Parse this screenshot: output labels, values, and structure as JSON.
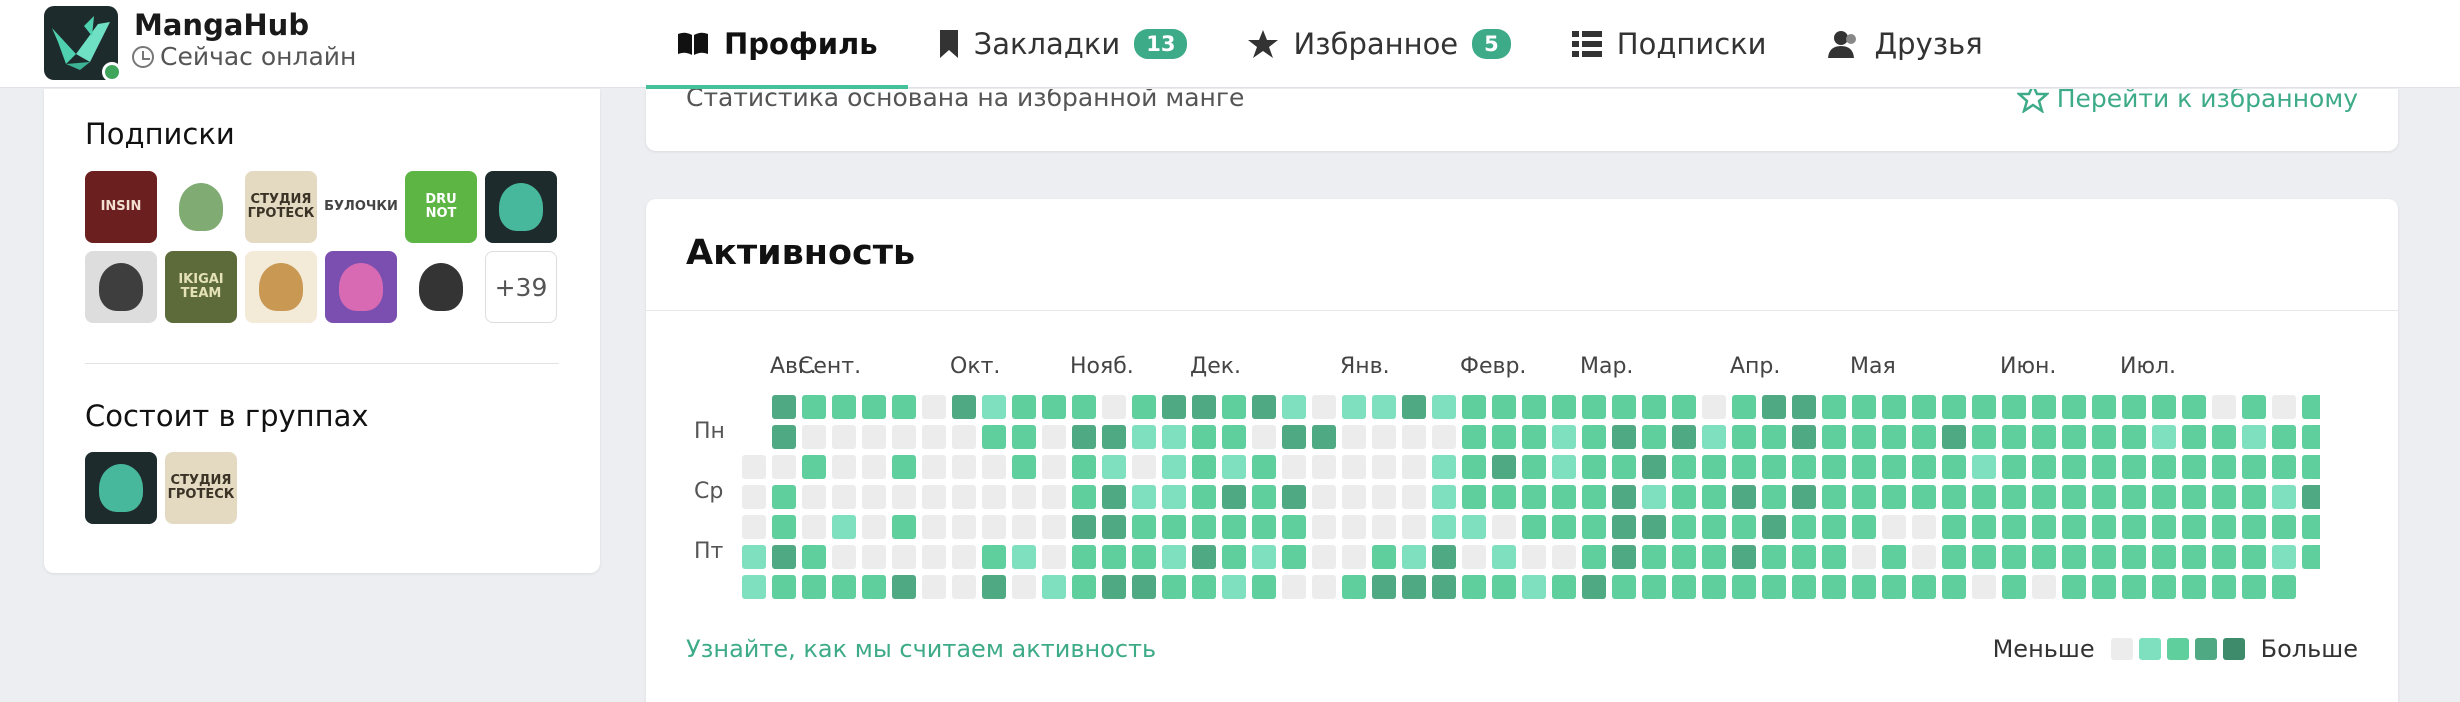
{
  "header": {
    "site_name": "MangaHub",
    "status": "Сейчас онлайн",
    "tabs": [
      {
        "label": "Профиль",
        "badge": null
      },
      {
        "label": "Закладки",
        "badge": "13"
      },
      {
        "label": "Избранное",
        "badge": "5"
      },
      {
        "label": "Подписки",
        "badge": null
      },
      {
        "label": "Друзья",
        "badge": null
      }
    ]
  },
  "sidebar": {
    "subscriptions_title": "Подписки",
    "subscriptions_more": "+39",
    "subscription_avatars": [
      {
        "text": "INSIN",
        "bg": "#6b1f1f",
        "fg": "#f3e0d0"
      },
      {
        "text": "",
        "bg": "#ffffff",
        "fg": "#6a9c5b"
      },
      {
        "text": "СТУДИЯ ГРОТЕСК",
        "bg": "#e4dac2",
        "fg": "#3a3326"
      },
      {
        "text": "БУЛОЧКИ",
        "bg": "#ffffff",
        "fg": "#444444"
      },
      {
        "text": "DRU NOT",
        "bg": "#5db544",
        "fg": "#ffffff"
      },
      {
        "text": "",
        "bg": "#1d2b2d",
        "fg": "#4fd1b0"
      },
      {
        "text": "",
        "bg": "#dddddd",
        "fg": "#222222"
      },
      {
        "text": "IKIGAI TEAM",
        "bg": "#5d6b3a",
        "fg": "#e6e2b8"
      },
      {
        "text": "",
        "bg": "#f3ead8",
        "fg": "#c18a3c"
      },
      {
        "text": "",
        "bg": "#7a4fb0",
        "fg": "#e86fb3"
      },
      {
        "text": "",
        "bg": "#ffffff",
        "fg": "#111111"
      }
    ],
    "groups_title": "Состоит в группах",
    "group_avatars": [
      {
        "text": "",
        "bg": "#1d2b2d",
        "fg": "#4fd1b0"
      },
      {
        "text": "СТУДИЯ ГРОТЕСК",
        "bg": "#e4dac2",
        "fg": "#3a3326"
      }
    ]
  },
  "stats_card": {
    "note": "Статистика основана на избранной манге",
    "link": "Перейти к избранному"
  },
  "activity": {
    "title": "Активность",
    "months": [
      "Авг.",
      "Сент.",
      "Окт.",
      "Нояб.",
      "Дек.",
      "Янв.",
      "Февр.",
      "Мар.",
      "Апр.",
      "Мая",
      "Июн.",
      "Июл."
    ],
    "days": [
      "Пн",
      "Ср",
      "Пт"
    ],
    "link": "Узнайте, как мы считаем активность",
    "legend_less": "Меньше",
    "legend_more": "Больше",
    "levels_colors": [
      "#ececec",
      "#7fe0bf",
      "#5fcf9e",
      "#4fa983",
      "#3d8b6a"
    ],
    "weeks": [
      [
        null,
        null,
        0,
        0,
        0,
        1,
        1
      ],
      [
        3,
        3,
        0,
        2,
        2,
        3,
        2
      ],
      [
        2,
        0,
        2,
        0,
        0,
        2,
        2
      ],
      [
        2,
        0,
        0,
        0,
        1,
        0,
        2
      ],
      [
        2,
        0,
        0,
        0,
        0,
        0,
        2
      ],
      [
        2,
        0,
        2,
        0,
        2,
        0,
        3
      ],
      [
        0,
        0,
        0,
        0,
        0,
        0,
        0
      ],
      [
        3,
        0,
        0,
        0,
        0,
        0,
        0
      ],
      [
        1,
        2,
        0,
        0,
        0,
        2,
        3
      ],
      [
        2,
        2,
        2,
        0,
        0,
        1,
        0
      ],
      [
        2,
        0,
        0,
        0,
        0,
        0,
        1
      ],
      [
        2,
        3,
        2,
        2,
        3,
        2,
        2
      ],
      [
        0,
        3,
        1,
        3,
        3,
        2,
        3
      ],
      [
        2,
        1,
        0,
        1,
        2,
        2,
        3
      ],
      [
        3,
        1,
        1,
        1,
        2,
        1,
        2
      ],
      [
        3,
        2,
        2,
        2,
        2,
        3,
        2
      ],
      [
        2,
        2,
        1,
        3,
        2,
        2,
        1
      ],
      [
        3,
        0,
        2,
        2,
        2,
        1,
        2
      ],
      [
        1,
        3,
        0,
        3,
        2,
        2,
        0
      ],
      [
        0,
        3,
        0,
        0,
        0,
        0,
        0
      ],
      [
        1,
        0,
        0,
        0,
        0,
        0,
        2
      ],
      [
        1,
        0,
        0,
        0,
        0,
        2,
        3
      ],
      [
        3,
        0,
        0,
        0,
        0,
        1,
        3
      ],
      [
        1,
        0,
        1,
        1,
        1,
        3,
        3
      ],
      [
        2,
        2,
        2,
        2,
        1,
        0,
        2
      ],
      [
        2,
        2,
        3,
        2,
        0,
        1,
        2
      ],
      [
        2,
        2,
        2,
        2,
        2,
        0,
        1
      ],
      [
        2,
        1,
        1,
        2,
        2,
        0,
        2
      ],
      [
        2,
        2,
        2,
        2,
        2,
        2,
        3
      ],
      [
        2,
        3,
        2,
        3,
        3,
        3,
        2
      ],
      [
        2,
        2,
        3,
        1,
        3,
        2,
        2
      ],
      [
        2,
        3,
        2,
        2,
        2,
        2,
        2
      ],
      [
        0,
        1,
        2,
        2,
        2,
        2,
        2
      ],
      [
        2,
        2,
        2,
        3,
        2,
        3,
        2
      ],
      [
        3,
        2,
        2,
        2,
        3,
        2,
        2
      ],
      [
        3,
        3,
        2,
        3,
        2,
        2,
        2
      ],
      [
        2,
        2,
        2,
        2,
        2,
        2,
        2
      ],
      [
        2,
        2,
        2,
        2,
        2,
        0,
        2
      ],
      [
        2,
        2,
        2,
        2,
        0,
        2,
        2
      ],
      [
        2,
        2,
        2,
        2,
        0,
        0,
        2
      ],
      [
        2,
        3,
        2,
        2,
        2,
        2,
        2
      ],
      [
        2,
        2,
        1,
        2,
        2,
        2,
        0
      ],
      [
        2,
        2,
        2,
        2,
        2,
        2,
        2
      ],
      [
        2,
        2,
        2,
        2,
        2,
        2,
        0
      ],
      [
        2,
        2,
        2,
        2,
        2,
        2,
        2
      ],
      [
        2,
        2,
        2,
        2,
        2,
        2,
        2
      ],
      [
        2,
        2,
        2,
        2,
        2,
        2,
        2
      ],
      [
        2,
        1,
        2,
        2,
        2,
        2,
        2
      ],
      [
        2,
        2,
        2,
        2,
        2,
        2,
        2
      ],
      [
        0,
        2,
        2,
        2,
        2,
        2,
        2
      ],
      [
        2,
        1,
        2,
        2,
        2,
        2,
        2
      ],
      [
        0,
        2,
        2,
        1,
        2,
        1,
        2
      ],
      [
        2,
        2,
        2,
        3,
        2,
        2,
        null
      ],
      [
        2,
        2,
        2,
        2,
        null,
        null,
        null
      ]
    ]
  }
}
